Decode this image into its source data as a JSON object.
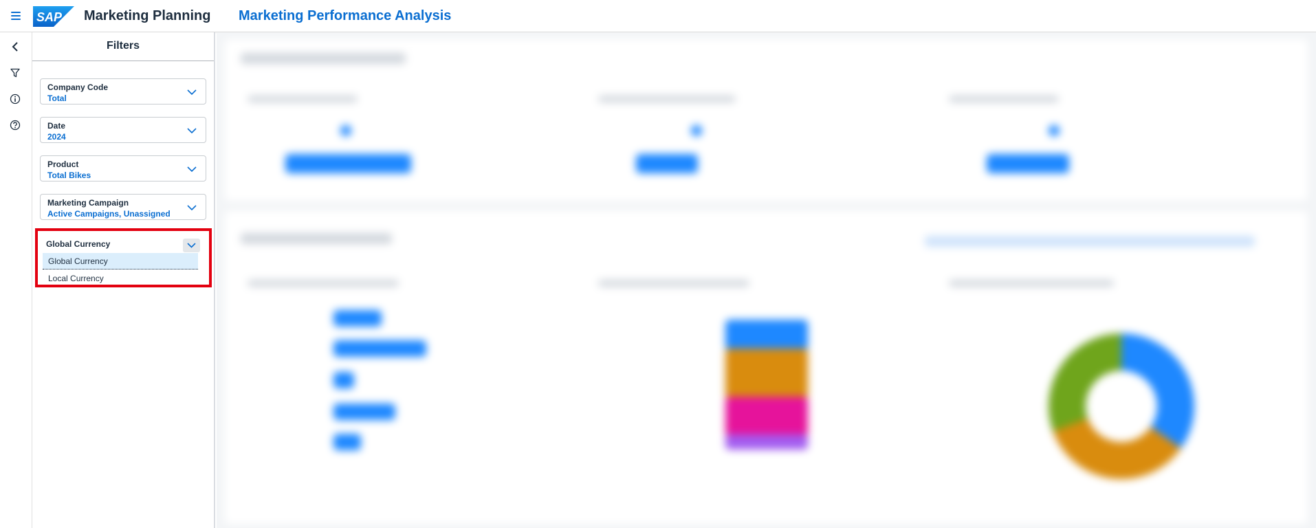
{
  "shell": {
    "logo_text": "SAP",
    "app_title": "Marketing Planning",
    "page_title": "Marketing Performance Analysis"
  },
  "rail": {
    "icons": [
      "back-icon",
      "filter-icon",
      "info-icon",
      "help-icon"
    ]
  },
  "filters": {
    "title": "Filters",
    "items": [
      {
        "label": "Company Code",
        "value": "Total"
      },
      {
        "label": "Date",
        "value": "2024"
      },
      {
        "label": "Product",
        "value": "Total Bikes"
      },
      {
        "label": "Marketing Campaign",
        "value": "Active Campaigns, Unassigned"
      }
    ],
    "currency": {
      "label": "Global Currency",
      "options": [
        "Global Currency",
        "Local Currency"
      ],
      "selected": "Global Currency"
    }
  },
  "colors": {
    "brand": "#0a6ed1",
    "highlight_border": "#e3000f",
    "chart_blue": "#1e88ff",
    "chart_orange": "#d98c0e",
    "chart_magenta": "#e6139b",
    "chart_green": "#6fa51c",
    "chart_purple": "#a35cf0"
  }
}
